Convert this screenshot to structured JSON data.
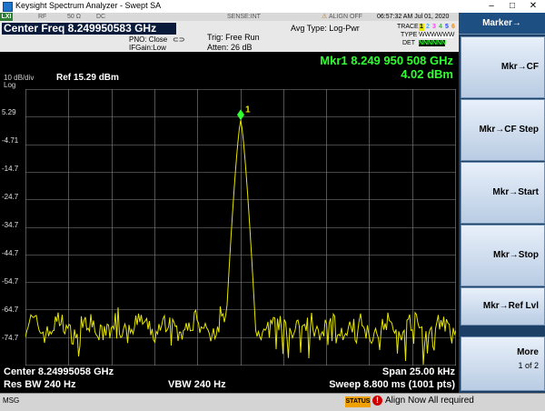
{
  "window": {
    "title": "Keysight Spectrum Analyzer - Swept SA",
    "minimize": "–",
    "maximize": "□",
    "close": "✕"
  },
  "status_row": {
    "lxi": "LXI",
    "rf": "RF",
    "impedance": "50 Ω",
    "coupling": "DC",
    "sense": "SENSE:INT",
    "align": "ALIGN OFF",
    "datetime": "06:57:32 AM Jul 01, 2020"
  },
  "info": {
    "center_freq": "Center Freq 8.249950583 GHz",
    "pno": "PNO: Close",
    "ifgain": "IFGain:Low",
    "trig": "Trig: Free Run",
    "atten": "Atten: 26 dB",
    "avg_type": "Avg Type: Log-Pwr",
    "trace_labels": [
      "TRACE",
      "TYPE",
      "DET"
    ],
    "trace_numbers": [
      "1",
      "2",
      "3",
      "4",
      "5",
      "6"
    ],
    "type_row": "W W W W W W",
    "det_row": "N N N N N N"
  },
  "marker": {
    "freq": "Mkr1 8.249 950 508 GHz",
    "level": "4.02 dBm",
    "label": "1"
  },
  "scale": {
    "per_div": "10 dB/div",
    "log": "Log",
    "ref": "Ref 15.29 dBm",
    "y_ticks": [
      "5.29",
      "-4.71",
      "-14.7",
      "-24.7",
      "-34.7",
      "-44.7",
      "-54.7",
      "-64.7",
      "-74.7"
    ]
  },
  "bottom": {
    "center": "Center 8.24995058 GHz",
    "rbw": "Res BW 240 Hz",
    "vbw": "VBW 240 Hz",
    "span": "Span 25.00 kHz",
    "sweep": "Sweep  8.800 ms (1001 pts)"
  },
  "messages": {
    "msg_label": "MSG",
    "status": "STATUS",
    "alert": "Align Now All required"
  },
  "softkeys": {
    "title": "Marker→",
    "keys": [
      "Mkr→CF",
      "Mkr→CF Step",
      "Mkr→Start",
      "Mkr→Stop",
      "Mkr→Ref Lvl"
    ],
    "more": "More",
    "page": "1 of 2"
  },
  "colors": {
    "trace": "#e6e600",
    "marker": "#30ff30",
    "grid": "#8a8a8a"
  }
}
